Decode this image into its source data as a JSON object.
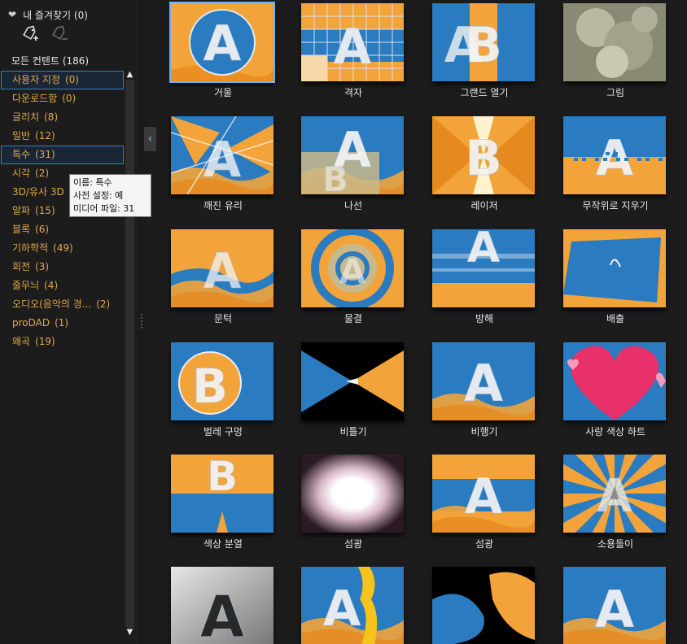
{
  "favorites": {
    "label": "내 즐겨찾기",
    "count": "(0)"
  },
  "all_content": {
    "label": "모든 컨텐트",
    "count": "(186)"
  },
  "categories": [
    {
      "label": "사용자 지정",
      "count": "(0)",
      "selected": true
    },
    {
      "label": "다운로드함",
      "count": "(0)"
    },
    {
      "label": "글리치",
      "count": "(8)"
    },
    {
      "label": "일반",
      "count": "(12)"
    },
    {
      "label": "특수",
      "count": "(31)",
      "selected": true
    },
    {
      "label": "시각",
      "count": "(2)"
    },
    {
      "label": "3D/유사 3D",
      "count": ""
    },
    {
      "label": "알파",
      "count": "(15)"
    },
    {
      "label": "블록",
      "count": "(6)"
    },
    {
      "label": "기하학적",
      "count": "(49)"
    },
    {
      "label": "회전",
      "count": "(3)"
    },
    {
      "label": "줄무늬",
      "count": "(4)"
    },
    {
      "label": "오디오(음악의 경...",
      "count": "(2)"
    },
    {
      "label": "proDAD",
      "count": "(1)"
    },
    {
      "label": "왜곡",
      "count": "(19)"
    }
  ],
  "tooltip": {
    "line1": "이름: 특수",
    "line2": "사전 설정: 예",
    "line3": "미디어 파일: 31"
  },
  "icons": {
    "favorite": "heart-icon",
    "add_favorite": "tag-add-icon",
    "remove_favorite": "tag-remove-icon",
    "collapse": "chevron-left-icon",
    "scroll_up": "triangle-up-icon",
    "scroll_down": "triangle-down-icon"
  },
  "tiles": [
    {
      "label": "거울",
      "selected": true
    },
    {
      "label": "격자"
    },
    {
      "label": "그랜드 열기"
    },
    {
      "label": "그림"
    },
    {
      "label": "깨진 유리"
    },
    {
      "label": "나선"
    },
    {
      "label": "레이저"
    },
    {
      "label": "무작위로 지우기"
    },
    {
      "label": "문턱"
    },
    {
      "label": "물결"
    },
    {
      "label": "방해"
    },
    {
      "label": "배출"
    },
    {
      "label": "벌레 구멍"
    },
    {
      "label": "비틀기"
    },
    {
      "label": "비행기"
    },
    {
      "label": "사랑 색상 하트"
    },
    {
      "label": "색상 분열"
    },
    {
      "label": "섬광"
    },
    {
      "label": "섬광"
    },
    {
      "label": "소용돌이"
    },
    {
      "label": ""
    },
    {
      "label": ""
    },
    {
      "label": ""
    },
    {
      "label": ""
    }
  ],
  "colors": {
    "accent": "#3a7bc1",
    "category_text": "#e0a84a",
    "orange": "#f2a43a",
    "blue": "#2a7bc0"
  }
}
